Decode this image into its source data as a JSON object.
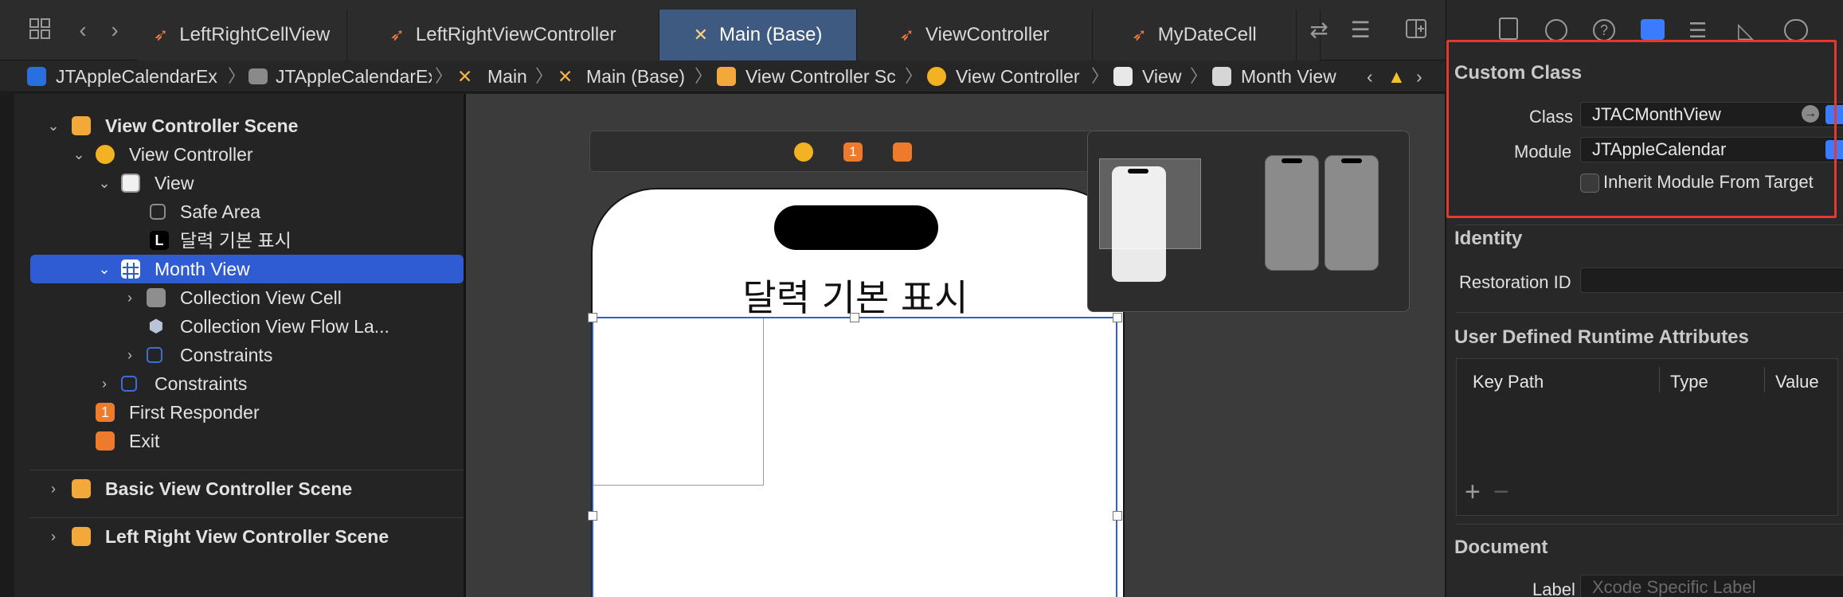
{
  "tabs": [
    {
      "label": "LeftRightCellView",
      "icon": "swift-icon"
    },
    {
      "label": "LeftRightViewController",
      "icon": "swift-icon"
    },
    {
      "label": "Main (Base)",
      "icon": "storyboard-icon"
    },
    {
      "label": "ViewController",
      "icon": "swift-icon"
    },
    {
      "label": "MyDateCell",
      "icon": "swift-icon"
    }
  ],
  "breadcrumbs": [
    "JTAppleCalendarEx",
    "JTAppleCalendarEx",
    "Main",
    "Main (Base)",
    "View Controller Sc",
    "View Controller",
    "View",
    "Month View"
  ],
  "outline": {
    "items": [
      {
        "label": "View Controller Scene"
      },
      {
        "label": "View Controller"
      },
      {
        "label": "View"
      },
      {
        "label": "Safe Area"
      },
      {
        "label": "달력 기본 표시"
      },
      {
        "label": "Month View"
      },
      {
        "label": "Collection View Cell"
      },
      {
        "label": "Collection View Flow La..."
      },
      {
        "label": "Constraints"
      },
      {
        "label": "Constraints"
      },
      {
        "label": "First Responder"
      },
      {
        "label": "Exit"
      }
    ],
    "scenes": [
      {
        "label": "Basic View Controller Scene"
      },
      {
        "label": "Left Right View Controller Scene"
      }
    ],
    "label_glyph": "L",
    "first_responder_glyph": "1"
  },
  "canvas": {
    "device_title": "달력 기본 표시",
    "scene_dock_badge": "1"
  },
  "inspector": {
    "custom_class": {
      "header": "Custom Class",
      "class_label": "Class",
      "class_value": "JTACMonthView",
      "module_label": "Module",
      "module_value": "JTAppleCalendar",
      "inherit_label": "Inherit Module From Target"
    },
    "identity": {
      "header": "Identity",
      "restoration_label": "Restoration ID",
      "restoration_value": ""
    },
    "runtime": {
      "header": "User Defined Runtime Attributes",
      "col_key": "Key Path",
      "col_type": "Type",
      "col_value": "Value"
    },
    "document": {
      "header": "Document",
      "label_label": "Label",
      "label_placeholder": "Xcode Specific Label"
    }
  },
  "colors": {
    "selection": "#2f5bd3",
    "active_tab": "#3e5a80",
    "swift_orange": "#f07a3c",
    "highlight_box": "#e8372b",
    "inspector_accent": "#3b7cff"
  }
}
